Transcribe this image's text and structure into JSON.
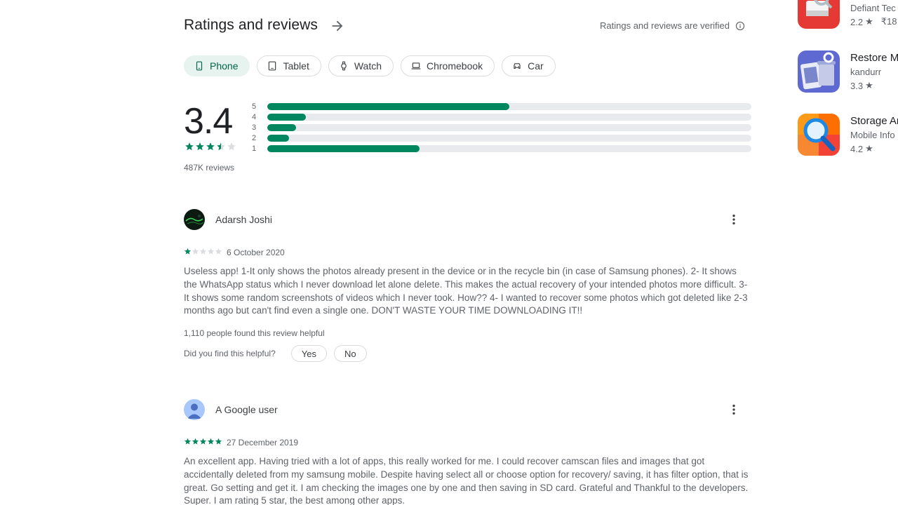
{
  "header": {
    "title": "Ratings and reviews",
    "verified_text": "Ratings and reviews are verified"
  },
  "device_chips": [
    {
      "label": "Phone",
      "icon": "phone-icon",
      "active": true
    },
    {
      "label": "Tablet",
      "icon": "tablet-icon",
      "active": false
    },
    {
      "label": "Watch",
      "icon": "watch-icon",
      "active": false
    },
    {
      "label": "Chromebook",
      "icon": "laptop-icon",
      "active": false
    },
    {
      "label": "Car",
      "icon": "car-icon",
      "active": false
    }
  ],
  "summary": {
    "average": "3.4",
    "average_stars": 3.5,
    "total_reviews": "487K reviews",
    "distribution": [
      {
        "label": "5",
        "fraction": 0.5
      },
      {
        "label": "4",
        "fraction": 0.08
      },
      {
        "label": "3",
        "fraction": 0.06
      },
      {
        "label": "2",
        "fraction": 0.045
      },
      {
        "label": "1",
        "fraction": 0.315
      }
    ]
  },
  "reviews": [
    {
      "name": "Adarsh Joshi",
      "avatar": "photo-avatar",
      "stars": 1,
      "date": "6 October 2020",
      "text": "Useless app! 1-It only shows the photos already present in the device or in the recycle bin (in case of Samsung phones). 2- It shows the WhatsApp status which I never download let alone delete. This makes the actual recovery of your intended photos more difficult. 3- It shows some random screenshots of videos which I never took. How?? 4- I wanted to recover some photos which got deleted like 2-3 months ago but can't find even a single one. DON'T WASTE YOUR TIME DOWNLOADING IT!!",
      "helpful_count": "1,110 people found this review helpful",
      "helpful_question": "Did you find this helpful?",
      "yes_label": "Yes",
      "no_label": "No"
    },
    {
      "name": "A Google user",
      "avatar": "default-user-avatar",
      "stars": 5,
      "date": "27 December 2019",
      "text": "An excellent app. Having tried with a lot of apps, this really worked for me. I could recover camscan files and images that got accidentally deleted from my samsung mobile. Despite having select all or choose option for recovery/ saving, it has filter option, that is great. Go setting and get it. I am checking the images one by one and then saving in SD card. Grateful and Thankful to the developers. Super. I am rating 5 star, the best among other apps."
    }
  ],
  "similar_apps": [
    {
      "name": "",
      "developer": "Defiant Tec",
      "rating": "2.2",
      "price": "₹18",
      "icon": "disk-recovery-icon"
    },
    {
      "name": "Restore M",
      "developer": "kandurr",
      "rating": "3.3",
      "price": "",
      "icon": "restore-trash-icon"
    },
    {
      "name": "Storage Ar",
      "developer": "Mobile Info",
      "rating": "4.2",
      "price": "",
      "icon": "magnifier-icon"
    }
  ],
  "colors": {
    "accent": "#01875f",
    "chip_active_bg": "#e6f3ef",
    "bar_track": "#e8eaed",
    "text_secondary": "#5f6368"
  }
}
